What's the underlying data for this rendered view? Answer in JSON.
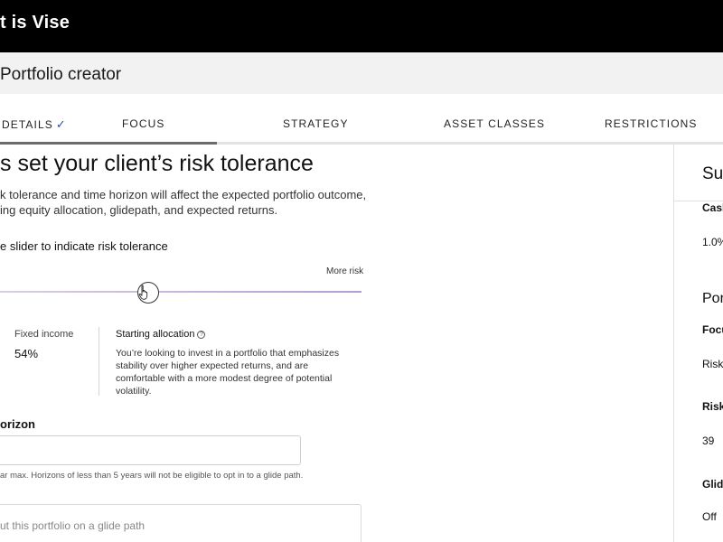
{
  "topbar": {
    "title": "t is Vise"
  },
  "subheader": {
    "title": "Portfolio creator"
  },
  "tabs": [
    {
      "label": "DETAILS",
      "check": "✓"
    },
    {
      "label": "FOCUS"
    },
    {
      "label": "STRATEGY"
    },
    {
      "label": "ASSET CLASSES"
    },
    {
      "label": "RESTRICTIONS"
    }
  ],
  "main": {
    "heading": "s set your client’s risk tolerance",
    "description": [
      "k tolerance and time horizon will affect the expected portfolio outcome,",
      "ing equity allocation, glidepath, and expected returns."
    ],
    "slider": {
      "label": "e slider to indicate risk tolerance",
      "max_label": "More risk",
      "level_fraction": 0.41
    },
    "fixed_income": {
      "label": "Fixed income",
      "value": "54%"
    },
    "starting_allocation": {
      "label": "Starting allocation",
      "info_icon": "info-icon",
      "text": [
        "You’re looking to invest in a portfolio that emphasizes",
        "stability over higher expected returns, and are",
        "comfortable with a more modest degree of potential",
        "volatility."
      ]
    },
    "horizon": {
      "label": "orizon",
      "input_value": "",
      "hint": "ar max. Horizons of less than 5 years will not be eligible to opt in to a glide path."
    },
    "glide_path": {
      "label": "ut this portfolio on a glide path"
    }
  },
  "summary_panel": {
    "title": "Su",
    "cash_label": "Cash",
    "cash_value": "1.0%",
    "portfolio_heading": "Por",
    "focus_label": "Focu",
    "focus_value": "Risk",
    "risk_label": "Risk",
    "risk_value": "39",
    "glide_label": "Glid",
    "glide_value": "Off"
  },
  "colors": {
    "topbar_bg": "#000000",
    "subheader_bg": "#f2f2f2",
    "check_accent": "#2a4ea8",
    "slider_track": "#b39dd1"
  }
}
